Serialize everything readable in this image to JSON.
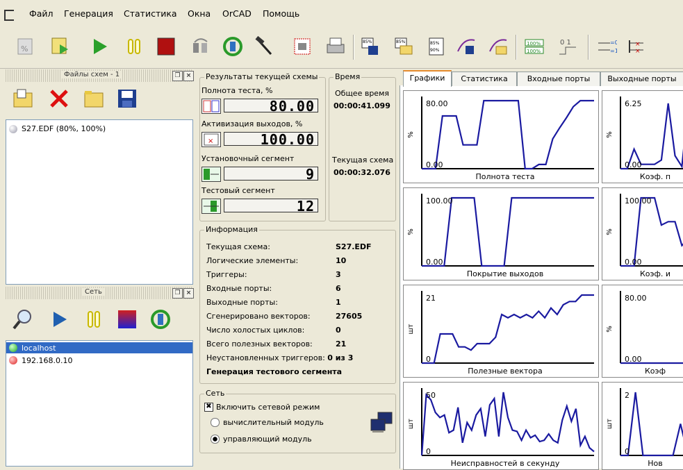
{
  "menu": [
    "Файл",
    "Генерация",
    "Статистика",
    "Окна",
    "OrCAD",
    "Помощь"
  ],
  "schemes_panel": {
    "title": "Файлы схем - 1",
    "items": [
      "S27.EDF (80%, 100%)"
    ]
  },
  "network_panel": {
    "title": "Сеть",
    "hosts": [
      {
        "name": "localhost",
        "status": "green"
      },
      {
        "name": "192.168.0.10",
        "status": "red"
      }
    ]
  },
  "results": {
    "title": "Результаты текущей схемы",
    "test_completeness_label": "Полнота теста, %",
    "test_completeness": "80.00",
    "activation_label": "Активизация выходов, %",
    "activation": "100.00",
    "setup_segment_label": "Установочный сегмент",
    "setup_segment": "9",
    "test_segment_label": "Тестовый сегмент",
    "test_segment": "12"
  },
  "time": {
    "title": "Время",
    "total_label": "Общее время",
    "total": "00:00:41.099",
    "current_label": "Текущая схема",
    "current": "00:00:32.076"
  },
  "info": {
    "title": "Информация",
    "rows": [
      {
        "label": "Текущая схема:",
        "value": "S27.EDF"
      },
      {
        "label": "Логические элементы:",
        "value": "10"
      },
      {
        "label": "Триггеры:",
        "value": "3"
      },
      {
        "label": "Входные порты:",
        "value": "6"
      },
      {
        "label": "Выходные порты:",
        "value": "1"
      },
      {
        "label": "Сгенерировано векторов:",
        "value": "27605"
      },
      {
        "label": "Число холостых циклов:",
        "value": "0"
      },
      {
        "label": "Всего полезных векторов:",
        "value": "21"
      }
    ],
    "uninstalled_label": "Неустановленных триггеров:",
    "uninstalled_value": "0 из 3",
    "status": "Генерация тестового сегмента"
  },
  "network_group": {
    "title": "Сеть",
    "enable_label": "Включить сетевой режим",
    "enable_checked": true,
    "mode_compute": "вычислительный модуль",
    "mode_control": "управляющий модуль",
    "selected": "control"
  },
  "tabs": [
    "Графики",
    "Статистика",
    "Входные порты",
    "Выходные порты"
  ],
  "active_tab": "Графики",
  "colors": {
    "line": "#1a1aa0",
    "axis": "#000000",
    "highlight": "#316ac5",
    "panel": "#ece9d8"
  },
  "chart_data": [
    {
      "type": "line",
      "xlabel": "Полнота теста",
      "ylabel": "%",
      "top_label": "80.00",
      "bottom_label": "0.00",
      "ylim": [
        0,
        80
      ],
      "values": [
        0,
        0,
        0,
        62,
        62,
        62,
        28,
        28,
        28,
        80,
        80,
        80,
        80,
        80,
        80,
        0,
        0,
        5,
        5,
        35,
        48,
        60,
        73,
        80,
        80,
        80
      ]
    },
    {
      "type": "line",
      "xlabel": "Коэф. п",
      "ylabel": "%",
      "top_label": "6.25",
      "bottom_label": "0.00",
      "ylim": [
        0,
        6.25
      ],
      "values": [
        0,
        0,
        1.8,
        0.4,
        0.4,
        0.4,
        0.8,
        6,
        1.2,
        0.2,
        6.5,
        0
      ]
    },
    {
      "type": "line",
      "xlabel": "Покрытие выходов",
      "ylabel": "%",
      "top_label": "100.00",
      "bottom_label": "0.00",
      "ylim": [
        0,
        100
      ],
      "values": [
        0,
        0,
        0,
        0,
        100,
        100,
        100,
        100,
        0,
        0,
        0,
        0,
        100,
        100,
        100,
        100,
        100,
        100,
        100,
        100,
        100,
        100,
        100,
        100
      ]
    },
    {
      "type": "line",
      "xlabel": "Коэф. и",
      "ylabel": "%",
      "top_label": "100.00",
      "bottom_label": "0.00",
      "ylim": [
        0,
        100
      ],
      "values": [
        0,
        0,
        0,
        100,
        100,
        100,
        60,
        65,
        65,
        30,
        40,
        40
      ]
    },
    {
      "type": "line",
      "xlabel": "Полезные вектора",
      "ylabel": "шт",
      "top_label": "21",
      "bottom_label": "0",
      "ylim": [
        0,
        21
      ],
      "values": [
        0,
        0,
        0,
        9,
        9,
        9,
        5,
        5,
        4,
        6,
        6,
        6,
        8,
        15,
        14,
        15,
        14,
        15,
        14,
        16,
        14,
        17,
        15,
        18,
        19,
        19,
        21,
        21,
        21
      ]
    },
    {
      "type": "line",
      "xlabel": "Коэф",
      "ylabel": "%",
      "top_label": "80.00",
      "bottom_label": "0.00",
      "ylim": [
        0,
        80
      ],
      "values": [
        0,
        0,
        0,
        0,
        0,
        0,
        0,
        0,
        0,
        0
      ]
    },
    {
      "type": "line",
      "xlabel": "Неисправностей в секунду",
      "ylabel": "шт",
      "top_label": "50",
      "bottom_label": "0",
      "ylim": [
        0,
        50
      ],
      "values": [
        0,
        48,
        44,
        34,
        30,
        32,
        18,
        20,
        38,
        10,
        26,
        20,
        32,
        37,
        15,
        40,
        45,
        15,
        55,
        30,
        20,
        19,
        12,
        20,
        14,
        16,
        11,
        12,
        17,
        12,
        10,
        28,
        39,
        27,
        37,
        8,
        15,
        6,
        3
      ]
    },
    {
      "type": "line",
      "xlabel": "Нов",
      "ylabel": "шт",
      "top_label": "2",
      "bottom_label": "0",
      "ylim": [
        0,
        2
      ],
      "values": [
        0,
        0,
        2,
        0,
        0,
        0,
        0,
        0,
        1,
        0,
        0
      ]
    }
  ]
}
